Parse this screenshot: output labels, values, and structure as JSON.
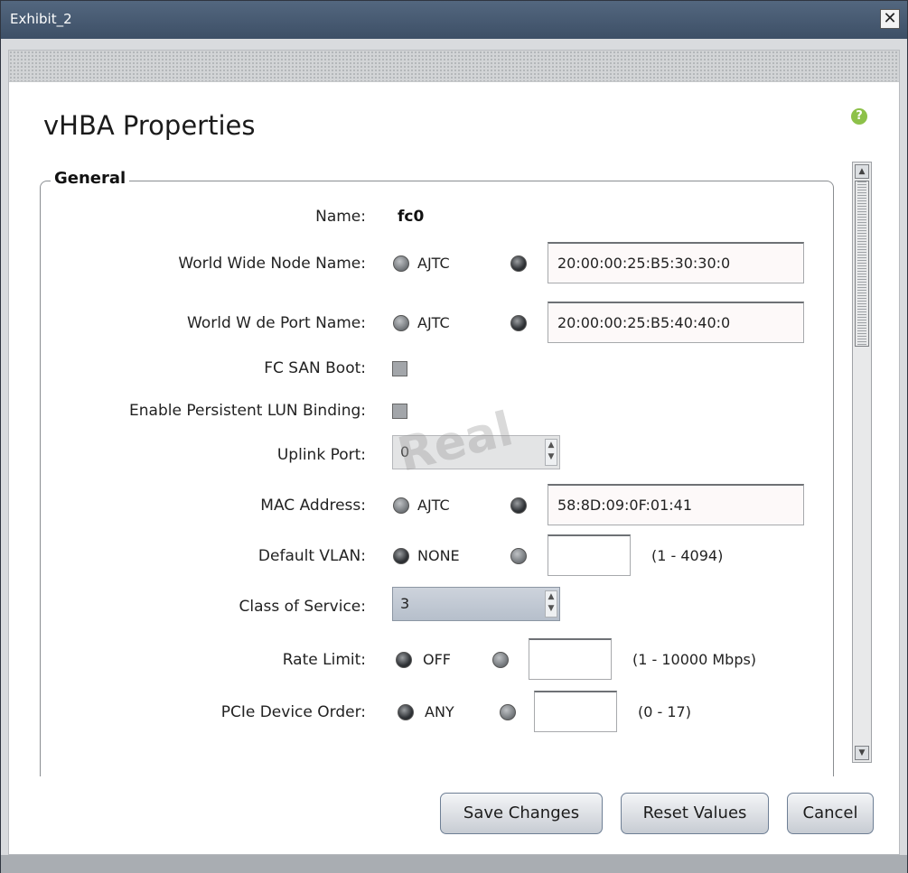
{
  "window": {
    "title": "Exhibit_2",
    "close_icon": "close-icon"
  },
  "dialog": {
    "heading": "vHBA Properties",
    "help": "?"
  },
  "general": {
    "legend": "General",
    "name": {
      "label": "Name:",
      "value": "fc0"
    },
    "wwnn": {
      "label": "World Wide Node Name:",
      "auto": "AJTC",
      "value": "20:00:00:25:B5:30:30:0",
      "selected": "manual"
    },
    "wwpn": {
      "label": "World W de Port Name:",
      "auto": "AJTC",
      "value": "20:00:00:25:B5:40:40:0",
      "selected": "manual"
    },
    "fc_san_boot": {
      "label": "FC SAN Boot:",
      "checked": false
    },
    "persistent_lun": {
      "label": "Enable Persistent LUN Binding:",
      "checked": false
    },
    "uplink_port": {
      "label": "Uplink Port:",
      "value": "0"
    },
    "mac": {
      "label": "MAC Address:",
      "auto": "AJTC",
      "value": "58:8D:09:0F:01:41",
      "selected": "manual"
    },
    "vlan": {
      "label": "Default VLAN:",
      "option": "NONE",
      "value": "",
      "range": "(1 - 4094)",
      "selected": "none"
    },
    "cos": {
      "label": "Class of Service:",
      "value": "3"
    },
    "rate_limit": {
      "label": "Rate Limit:",
      "option": "OFF",
      "value": "",
      "range": "(1 - 10000 Mbps)",
      "selected": "off"
    },
    "pcie_order": {
      "label": "PCIe Device Order:",
      "option": "ANY",
      "value": "",
      "range": "(0 - 17)",
      "selected": "any"
    }
  },
  "watermark": "Real",
  "buttons": {
    "save": "Save Changes",
    "reset": "Reset Values",
    "cancel": "Cancel"
  }
}
